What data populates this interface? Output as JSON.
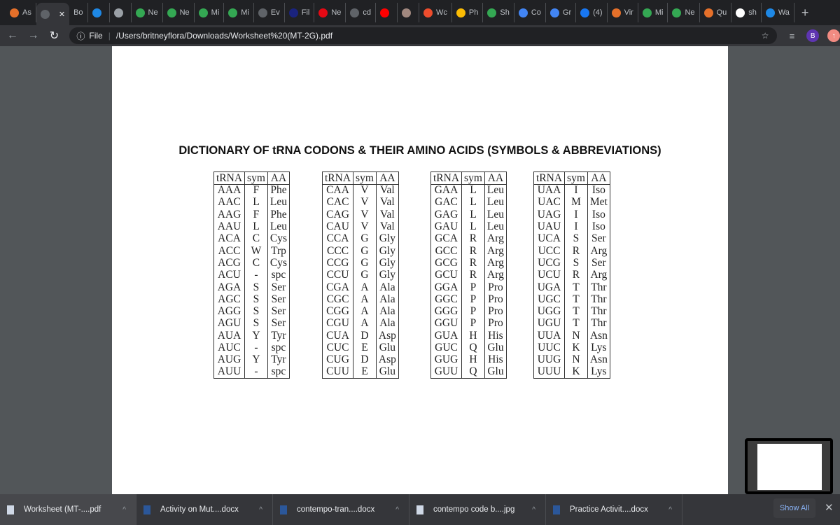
{
  "browser": {
    "tabs": [
      {
        "label": "As",
        "icon": "bartleby-icon",
        "color": "#e5702a"
      },
      {
        "label": "",
        "icon": "globe-icon",
        "color": "#5f6368",
        "active": true,
        "close": "✕"
      },
      {
        "label": "Bo",
        "icon": "",
        "color": ""
      },
      {
        "label": "",
        "icon": "bing-icon",
        "color": "#1e88e5"
      },
      {
        "label": "",
        "icon": "speaker-icon",
        "color": "#9aa0a6"
      },
      {
        "label": "Ne",
        "icon": "google-drive-icon",
        "color": "#34a853"
      },
      {
        "label": "Ne",
        "icon": "google-drive-icon",
        "color": "#34a853"
      },
      {
        "label": "Mi",
        "icon": "google-drive-icon",
        "color": "#34a853"
      },
      {
        "label": "Mi",
        "icon": "google-drive-icon",
        "color": "#34a853"
      },
      {
        "label": "Ev",
        "icon": "globe-icon",
        "color": "#5f6368"
      },
      {
        "label": "Fil",
        "icon": "b-icon",
        "color": "#1a237e"
      },
      {
        "label": "Ne",
        "icon": "netflix-icon",
        "color": "#e50914"
      },
      {
        "label": "cd",
        "icon": "globe-icon",
        "color": "#5f6368"
      },
      {
        "label": "",
        "icon": "youtube-icon",
        "color": "#ff0000"
      },
      {
        "label": "",
        "icon": "package-icon",
        "color": "#a1887f"
      },
      {
        "label": "Wc",
        "icon": "shopee-icon",
        "color": "#ee4d2d"
      },
      {
        "label": "Ph",
        "icon": "google-photos-icon",
        "color": "#fbbc04"
      },
      {
        "label": "Sh",
        "icon": "google-drive-icon",
        "color": "#34a853"
      },
      {
        "label": "Co",
        "icon": "google-docs-icon",
        "color": "#4285f4"
      },
      {
        "label": "Gr",
        "icon": "google-docs-icon",
        "color": "#4285f4"
      },
      {
        "label": "(4)",
        "icon": "facebook-icon",
        "color": "#1877f2"
      },
      {
        "label": "Vir",
        "icon": "bartleby-icon",
        "color": "#e5702a"
      },
      {
        "label": "Mi",
        "icon": "google-drive-icon",
        "color": "#34a853"
      },
      {
        "label": "Ne",
        "icon": "google-drive-icon",
        "color": "#34a853"
      },
      {
        "label": "Qu",
        "icon": "bartleby-icon",
        "color": "#e5702a"
      },
      {
        "label": "sh",
        "icon": "google-icon",
        "color": "#ffffff"
      },
      {
        "label": "Wa",
        "icon": "play-icon",
        "color": "#1e88e5"
      }
    ],
    "new_tab": "+",
    "address_scheme": "File",
    "address_url": "/Users/britneyflora/Downloads/Worksheet%20(MT-2G).pdf",
    "profile_initial": "B"
  },
  "document": {
    "title": "DICTIONARY OF tRNA CODONS & THEIR AMINO ACIDS (SYMBOLS & ABBREVIATIONS)",
    "headers": [
      "tRNA",
      "sym",
      "AA"
    ],
    "tables": [
      [
        [
          "AAA",
          "F",
          "Phe"
        ],
        [
          "AAC",
          "L",
          "Leu"
        ],
        [
          "AAG",
          "F",
          "Phe"
        ],
        [
          "AAU",
          "L",
          "Leu"
        ],
        [
          "ACA",
          "C",
          "Cys"
        ],
        [
          "ACC",
          "W",
          "Trp"
        ],
        [
          "ACG",
          "C",
          "Cys"
        ],
        [
          "ACU",
          "-",
          "spc"
        ],
        [
          "AGA",
          "S",
          "Ser"
        ],
        [
          "AGC",
          "S",
          "Ser"
        ],
        [
          "AGG",
          "S",
          "Ser"
        ],
        [
          "AGU",
          "S",
          "Ser"
        ],
        [
          "AUA",
          "Y",
          "Tyr"
        ],
        [
          "AUC",
          "-",
          "spc"
        ],
        [
          "AUG",
          "Y",
          "Tyr"
        ],
        [
          "AUU",
          "-",
          "spc"
        ]
      ],
      [
        [
          "CAA",
          "V",
          "Val"
        ],
        [
          "CAC",
          "V",
          "Val"
        ],
        [
          "CAG",
          "V",
          "Val"
        ],
        [
          "CAU",
          "V",
          "Val"
        ],
        [
          "CCA",
          "G",
          "Gly"
        ],
        [
          "CCC",
          "G",
          "Gly"
        ],
        [
          "CCG",
          "G",
          "Gly"
        ],
        [
          "CCU",
          "G",
          "Gly"
        ],
        [
          "CGA",
          "A",
          "Ala"
        ],
        [
          "CGC",
          "A",
          "Ala"
        ],
        [
          "CGG",
          "A",
          "Ala"
        ],
        [
          "CGU",
          "A",
          "Ala"
        ],
        [
          "CUA",
          "D",
          "Asp"
        ],
        [
          "CUC",
          "E",
          "Glu"
        ],
        [
          "CUG",
          "D",
          "Asp"
        ],
        [
          "CUU",
          "E",
          "Glu"
        ]
      ],
      [
        [
          "GAA",
          "L",
          "Leu"
        ],
        [
          "GAC",
          "L",
          "Leu"
        ],
        [
          "GAG",
          "L",
          "Leu"
        ],
        [
          "GAU",
          "L",
          "Leu"
        ],
        [
          "GCA",
          "R",
          "Arg"
        ],
        [
          "GCC",
          "R",
          "Arg"
        ],
        [
          "GCG",
          "R",
          "Arg"
        ],
        [
          "GCU",
          "R",
          "Arg"
        ],
        [
          "GGA",
          "P",
          "Pro"
        ],
        [
          "GGC",
          "P",
          "Pro"
        ],
        [
          "GGG",
          "P",
          "Pro"
        ],
        [
          "GGU",
          "P",
          "Pro"
        ],
        [
          "GUA",
          "H",
          "His"
        ],
        [
          "GUC",
          "Q",
          "Glu"
        ],
        [
          "GUG",
          "H",
          "His"
        ],
        [
          "GUU",
          "Q",
          "Glu"
        ]
      ],
      [
        [
          "UAA",
          "I",
          "Iso"
        ],
        [
          "UAC",
          "M",
          "Met"
        ],
        [
          "UAG",
          "I",
          "Iso"
        ],
        [
          "UAU",
          "I",
          "Iso"
        ],
        [
          "UCA",
          "S",
          "Ser"
        ],
        [
          "UCC",
          "R",
          "Arg"
        ],
        [
          "UCG",
          "S",
          "Ser"
        ],
        [
          "UCU",
          "R",
          "Arg"
        ],
        [
          "UGA",
          "T",
          "Thr"
        ],
        [
          "UGC",
          "T",
          "Thr"
        ],
        [
          "UGG",
          "T",
          "Thr"
        ],
        [
          "UGU",
          "T",
          "Thr"
        ],
        [
          "UUA",
          "N",
          "Asn"
        ],
        [
          "UUC",
          "K",
          "Lys"
        ],
        [
          "UUG",
          "N",
          "Asn"
        ],
        [
          "UUU",
          "K",
          "Lys"
        ]
      ]
    ]
  },
  "downloads": {
    "items": [
      {
        "name": "Worksheet (MT-....pdf",
        "icon": "file-icon"
      },
      {
        "name": "Activity on Mut....docx",
        "icon": "word-doc-icon"
      },
      {
        "name": "contempo-tran....docx",
        "icon": "word-doc-icon"
      },
      {
        "name": "contempo code b....jpg",
        "icon": "file-icon"
      },
      {
        "name": "Practice Activit....docx",
        "icon": "word-doc-icon"
      }
    ],
    "show_all": "Show All",
    "close": "✕"
  }
}
